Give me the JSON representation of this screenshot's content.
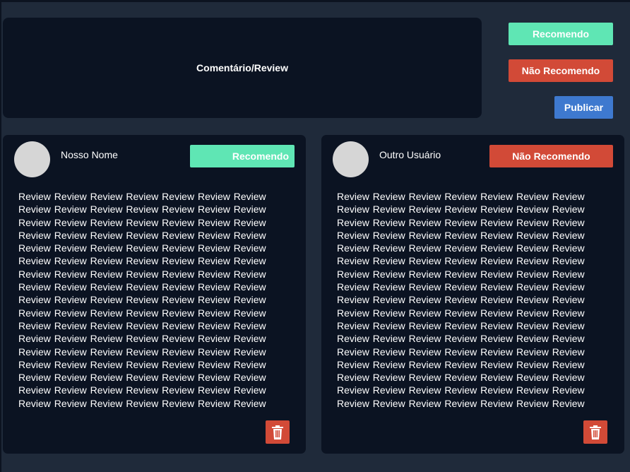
{
  "compose": {
    "placeholder": "Comentário/Review"
  },
  "actions": {
    "recommend_label": "Recomendo",
    "not_recommend_label": "Não Recomendo",
    "publish_label": "Publicar"
  },
  "reviews": [
    {
      "user_name": "Nosso Nome",
      "badge_label": "Recomendo",
      "badge_type": "recommend",
      "text": "Review Review Review Review Review Review Review Review Review Review Review Review Review Review Review Review Review Review Review Review Review Review Review Review Review Review Review Review Review Review Review Review Review Review Review Review Review Review Review Review Review Review Review Review Review Review Review Review Review Review Review Review Review Review Review Review Review Review Review Review Review Review Review Review Review Review Review Review Review Review Review Review Review Review Review Review Review Review Review Review Review Review Review Review Review Review Review Review Review Review Review Review Review Review Review Review Review Review Review Review Review Review Review Review Review Review Review Review Review Review Review Review Review Review Review Review Review Review Review",
      "delete_icon": "trash-icon"
    },
    {
      "user_name": "Outro Usuário",
      "badge_label": "Não Recomendo",
      "badge_type": "not-recommend",
      "text": "Review Review Review Review Review Review Review Review Review Review Review Review Review Review Review Review Review Review Review Review Review Review Review Review Review Review Review Review Review Review Review Review Review Review Review Review Review Review Review Review Review Review Review Review Review Review Review Review Review Review Review Review Review Review Review Review Review Review Review Review Review Review Review Review Review Review Review Review Review Review Review Review Review Review Review Review Review Review Review Review Review Review Review Review Review Review Review Review Review Review Review Review Review Review Review Review Review Review Review Review Review Review Review Review Review Review Review Review Review Review Review Review Review Review Review Review Review Review Review",
      "delete_icon": "trash-icon"
    }
  ],
  "colors": {
    "background": "#1f2a3a",
    "panel": "#0b1322",
    "recommend": "#5fe6b4",
    "not_recommend": "#d24a37",
    "publish": "#3e79cf"
  }
}
